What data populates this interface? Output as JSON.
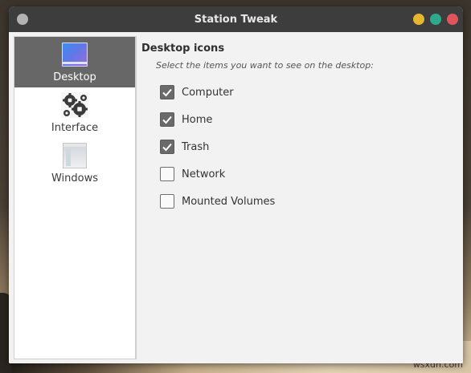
{
  "window": {
    "title": "Station Tweak"
  },
  "sidebar": {
    "items": [
      {
        "label": "Desktop",
        "icon": "desktop-icon",
        "active": true
      },
      {
        "label": "Interface",
        "icon": "gears-icon",
        "active": false
      },
      {
        "label": "Windows",
        "icon": "window-icon",
        "active": false
      }
    ]
  },
  "panel": {
    "heading": "Desktop icons",
    "subtitle": "Select the items you want to see on the desktop:",
    "options": [
      {
        "label": "Computer",
        "checked": true
      },
      {
        "label": "Home",
        "checked": true
      },
      {
        "label": "Trash",
        "checked": true
      },
      {
        "label": "Network",
        "checked": false
      },
      {
        "label": "Mounted Volumes",
        "checked": false
      }
    ]
  },
  "watermark": "wsxdn.com",
  "colors": {
    "titlebar": "#3d3d3d",
    "active_item": "#676767",
    "minimize": "#e6b62f",
    "maximize": "#2fa98e",
    "close": "#e0555c",
    "checkbox_checked": "#6a6a6a"
  }
}
